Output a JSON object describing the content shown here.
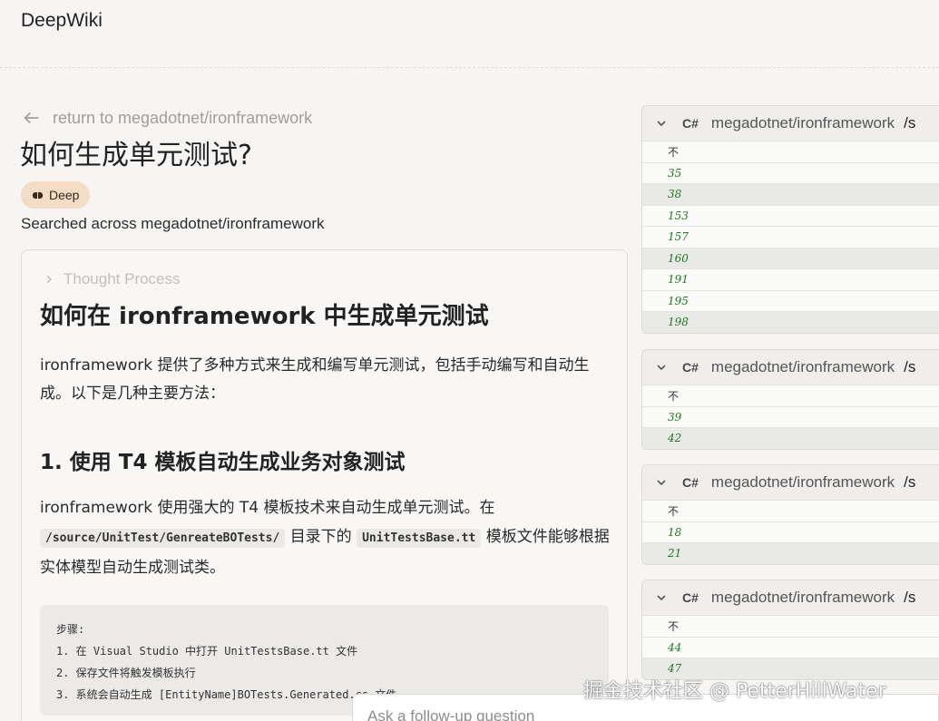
{
  "header": {
    "brand": "DeepWiki"
  },
  "nav": {
    "back_label": "return to megadotnet/ironframework"
  },
  "question": {
    "title": "如何生成单元测试?"
  },
  "badge": {
    "label": "Deep",
    "color": "#f4dcc7"
  },
  "search_status": "Searched across megadotnet/ironframework",
  "answer": {
    "thought_label": "Thought Process",
    "heading": "如何在 ironframework 中生成单元测试",
    "intro": "ironframework 提供了多种方式来生成和编写单元测试，包括手动编写和自动生成。以下是几种主要方法：",
    "section1_heading": "1. 使用 T4 模板自动生成业务对象测试",
    "section1_text_a": "ironframework 使用强大的 T4 模板技术来自动生成单元测试。在",
    "section1_code_a": "/source/UnitTest/GenreateBOTests/",
    "section1_text_b": "目录下的",
    "section1_code_b": "UnitTestsBase.tt",
    "section1_text_c": "模板文件能够根据实体模型自动生成测试类。",
    "code_lines": [
      "步骤:",
      "1. 在 Visual Studio 中打开 UnitTestsBase.tt 文件",
      "2. 保存文件将触发模板执行",
      "3. 系统会自动生成 [EntityName]BOTests.Generated.cs 文件"
    ]
  },
  "panels": [
    {
      "lang": "C#",
      "repo": "megadotnet/ironframework",
      "path": "/s",
      "top_row": "不",
      "lines": [
        "35",
        "38",
        "153",
        "157",
        "160",
        "191",
        "195",
        "198"
      ]
    },
    {
      "lang": "C#",
      "repo": "megadotnet/ironframework",
      "path": "/s",
      "top_row": "不",
      "lines": [
        "39",
        "42"
      ]
    },
    {
      "lang": "C#",
      "repo": "megadotnet/ironframework",
      "path": "/s",
      "top_row": "不",
      "lines": [
        "18",
        "21"
      ]
    },
    {
      "lang": "C#",
      "repo": "megadotnet/ironframework",
      "path": "/s",
      "top_row": "不",
      "lines": [
        "44",
        "47"
      ]
    }
  ],
  "followup": {
    "placeholder": "Ask a follow-up question"
  },
  "watermark": "掘金技术社区 @ PetterHillWater"
}
